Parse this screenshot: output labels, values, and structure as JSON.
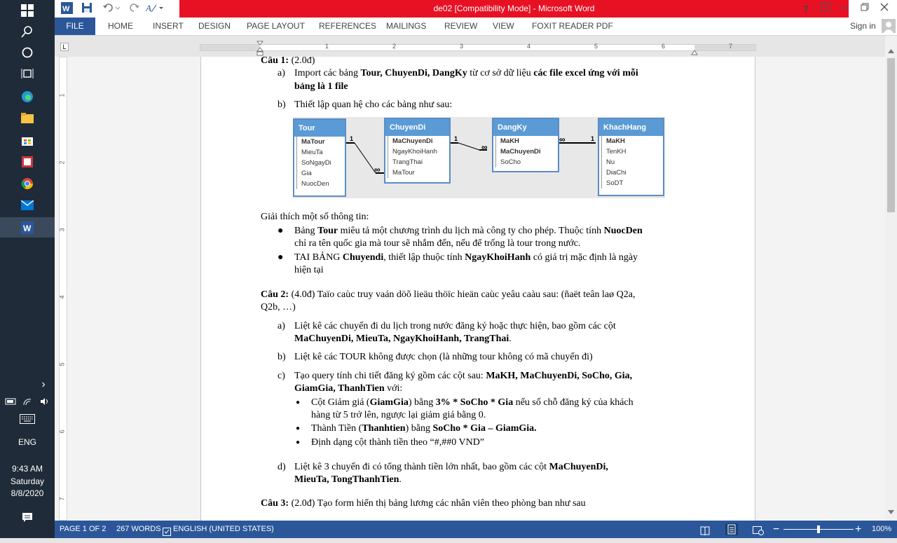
{
  "taskbar": {
    "icons": [
      "windows-logo-icon",
      "search-icon",
      "cortana-icon",
      "task-view-icon",
      "edge-icon",
      "file-explorer-icon",
      "store-icon",
      "app-icon",
      "chrome-icon",
      "mail-icon",
      "word-icon"
    ],
    "expand": "›",
    "lang": "ENG",
    "time": "9:43 AM",
    "day": "Saturday",
    "date": "8/8/2020"
  },
  "window": {
    "title": "de02 [Compatibility Mode] -  Microsoft Word",
    "help": "?",
    "sign_in": "Sign in"
  },
  "ribbon": {
    "tabs": [
      "FILE",
      "HOME",
      "INSERT",
      "DESIGN",
      "PAGE LAYOUT",
      "REFERENCES",
      "MAILINGS",
      "REVIEW",
      "VIEW",
      "FOXIT READER PDF"
    ]
  },
  "ruler": {
    "numbers": [
      "1",
      "2",
      "3",
      "4",
      "5",
      "6",
      "7"
    ],
    "vnumbers": [
      "1",
      "2",
      "3",
      "4",
      "5",
      "6",
      "7"
    ]
  },
  "document": {
    "q1_head": "Câu 1:",
    "q1_points": " (2.0đ)",
    "q1a_letter": "a)",
    "q1a_t1": "Import các bảng ",
    "q1a_b1": "Tour, ChuyenDi, DangKy",
    "q1a_t2": " từ cơ sở dữ liệu ",
    "q1a_b2": "các file excel ứng với mỗi",
    "q1a_b3": "bảng là 1 file",
    "q1b_letter": "b)",
    "q1b_text": "Thiết lập quan hệ cho các bảng như sau:",
    "diagram": {
      "tables": [
        {
          "name": "Tour",
          "fields": [
            "MaTour",
            "MieuTa",
            "SoNgayDi",
            "Gia",
            "NuocDen"
          ],
          "keys": [
            0
          ]
        },
        {
          "name": "ChuyenDi",
          "fields": [
            "MaChuyenDi",
            "NgayKhoiHanh",
            "TrangThai",
            "MaTour"
          ],
          "keys": [
            0
          ]
        },
        {
          "name": "DangKy",
          "fields": [
            "MaKH",
            "MaChuyenDi",
            "SoCho"
          ],
          "keys": [
            0,
            1
          ]
        },
        {
          "name": "KhachHang",
          "fields": [
            "MaKH",
            "TenKH",
            "Nu",
            "DiaChi",
            "SoDT"
          ],
          "keys": [
            0
          ]
        }
      ],
      "one": "1",
      "many": "∞"
    },
    "explain_head": "Giải thích một số thông tin:",
    "bul1_t1": "Bảng ",
    "bul1_b1": "Tour",
    "bul1_t2": " miêu tả một chương trình du lịch mà công ty cho phép. Thuộc tính ",
    "bul1_b2": "NuocDen",
    "bul1_l2": "chỉ ra tên quốc gia mà tour sẽ nhắm đến, nếu để trống là tour trong nước.",
    "bul2_t1": "TAI BẢNG ",
    "bul2_b1": "Chuyendi",
    "bul2_t2": ", thiết lập thuộc tính ",
    "bul2_b2": "NgayKhoiHanh",
    "bul2_t3": " có giá trị mặc định là ngày",
    "bul2_l2": "hiện tại",
    "q2_head": "Câu 2:",
    "q2_text": " (4.0đ) Taïo caùc truy vaán döõ lieäu thöïc hieän caùc yeâu caàu sau: (ñaët teân laø Q2a,",
    "q2_l2": "Q2b, …)",
    "q2a_letter": "a)",
    "q2a_text": "Liệt kê các chuyến đi du lịch trong nước đăng ký hoặc thực hiện, bao gồm các cột",
    "q2a_b": "MaChuyenDi, MieuTa, NgayKhoiHanh, TrangThai",
    "q2a_end": ".",
    "q2b_letter": "b)",
    "q2b_text": "Liệt kê các TOUR không được chọn (là những tour không có mã chuyến đi)",
    "q2c_letter": "c)",
    "q2c_t1": "Tạo query tính chi tiết đăng ký gồm các cột sau: ",
    "q2c_b1": "MaKH, MaChuyenDi, SoCho, Gia,",
    "q2c_b2": "GiamGia, ThanhTien",
    "q2c_t2": " với:",
    "c1_t1": "Cột Giảm giá (",
    "c1_b1": "GiamGia",
    "c1_t2": ") bằng ",
    "c1_b2": "3% * SoCho * Gia",
    "c1_t3": " nếu số chỗ đăng ký của khách",
    "c1_l2": "hàng từ 5 trở lên, ngược lại giảm giá bằng 0.",
    "c2_t1": "Thành Tiền (",
    "c2_b1": "Thanhtien",
    "c2_t2": ") bằng ",
    "c2_b2": "SoCho * Gia – GiamGia.",
    "c3_text": "Định dạng cột thành tiền theo “#,##0 VND”",
    "q2d_letter": "d)",
    "q2d_text": "Liệt kê 3 chuyến đi có tổng thành tiền lớn nhất, bao gồm các cột ",
    "q2d_b1": "MaChuyenDi,",
    "q2d_b2": "MieuTa, TongThanhTien",
    "q2d_end": ".",
    "q3_head": "Câu 3:",
    "q3_text": " (2.0đ) Tạo form hiển thị bảng lương các nhân viên theo phòng ban như sau"
  },
  "status": {
    "page": "PAGE 1 OF 2",
    "words": "267 WORDS",
    "lang": "ENGLISH (UNITED STATES)",
    "zoom": "100%",
    "zoom_level": 1.0
  },
  "colors": {
    "title_red": "#e81123",
    "word_blue": "#2b579a",
    "table_header": "#5b9bd5",
    "taskbar": "#1f2b39"
  }
}
